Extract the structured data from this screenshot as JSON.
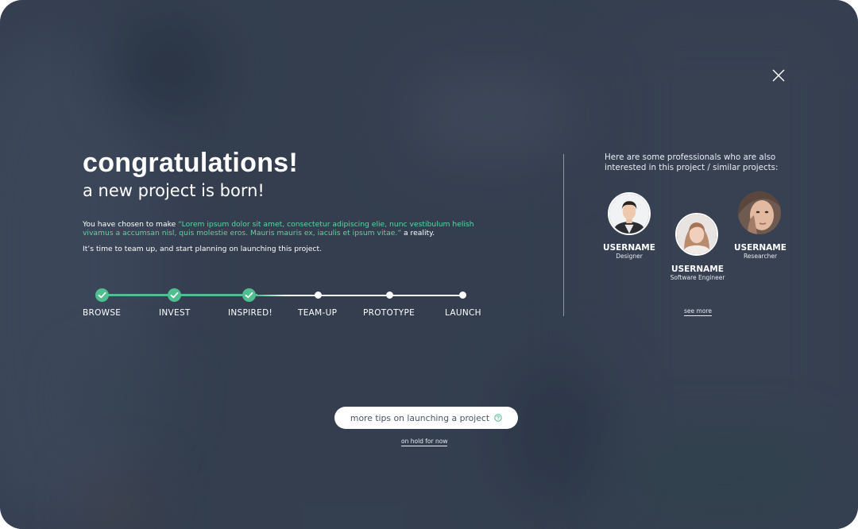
{
  "modal": {
    "title": "congratulations!",
    "subtitle": "a new project is born!",
    "intro_prefix": "You have chosen to make ",
    "intro_quote": "“Lorem ipsum dolor sit amet, consectetur adipiscing elie, nunc vestibulum helish vivamus a accumsan nisl, quis molestie eros. Mauris mauris ex, iaculis et ipsum vitae.”",
    "intro_suffix": " a reality.",
    "call_to_action": "It’s time to team up, and start planning on launching this project."
  },
  "progress": {
    "steps": [
      {
        "label": "BROWSE",
        "done": true
      },
      {
        "label": "INVEST",
        "done": true
      },
      {
        "label": "INSPIRED!",
        "done": true
      },
      {
        "label": "TEAM-UP",
        "done": false
      },
      {
        "label": "PROTOTYPE",
        "done": false
      },
      {
        "label": "LAUNCH",
        "done": false
      }
    ]
  },
  "professionals": {
    "intro": "Here are some professionals who are also interested in this project / similar projects:",
    "people": [
      {
        "username": "USERNAME",
        "role": "Designer"
      },
      {
        "username": "USERNAME",
        "role": "Software Engineer"
      },
      {
        "username": "USERNAME",
        "role": "Researcher"
      }
    ],
    "see_more": "see more"
  },
  "actions": {
    "tips_label": "more tips on launching a project",
    "hold_label": "on hold for now"
  },
  "colors": {
    "accent": "#4fbf90",
    "quote": "#5fd3a2",
    "backdrop": "#3b4657"
  },
  "icons": {
    "close": "close-icon",
    "check": "check-icon",
    "help": "help-circle-icon"
  }
}
